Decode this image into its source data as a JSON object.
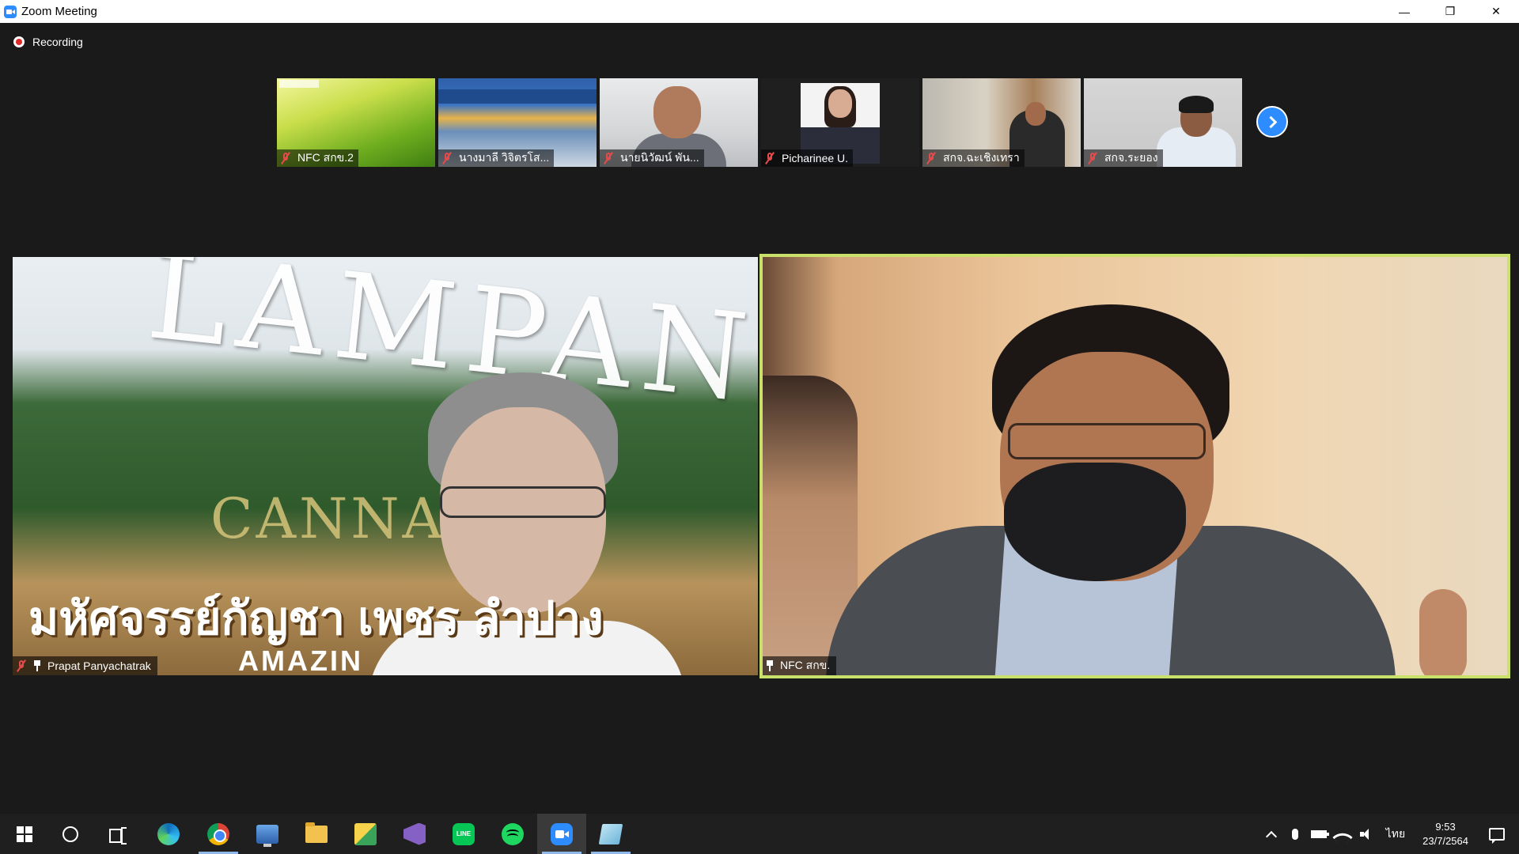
{
  "window": {
    "title": "Zoom Meeting",
    "controls": {
      "minimize": "—",
      "restore": "❐",
      "close": "✕"
    }
  },
  "recording": {
    "label": "Recording"
  },
  "thumbnails": [
    {
      "name": "NFC สกข.2",
      "muted": true
    },
    {
      "name": "นางมาลี วิจิตรโส...",
      "muted": true
    },
    {
      "name": "นายนิวัฒน์ พัน...",
      "muted": true
    },
    {
      "name": "Picharinee U.",
      "muted": true
    },
    {
      "name": "สกจ.ฉะเชิงเทรา",
      "muted": true
    },
    {
      "name": "สกจ.ระยอง",
      "muted": true
    }
  ],
  "thumbnail_banner_text": "LAMPANG",
  "main_videos": [
    {
      "name": "Prapat Panyachatrak",
      "muted": true,
      "pinned": true,
      "background_text": {
        "title": "LAMPANG",
        "subtitle": "CANNABI",
        "thai": "มหัศจรรย์กัญชา เพชร   ลำปาง",
        "english": "AMAZIN"
      }
    },
    {
      "name": "NFC สกข.",
      "muted": false,
      "pinned": true,
      "active_speaker": true
    }
  ],
  "taskbar": {
    "apps": [
      "start",
      "cortana",
      "task-view",
      "edge",
      "chrome",
      "remote-desktop",
      "file-explorer",
      "tool",
      "visual-studio",
      "line",
      "spotify",
      "zoom",
      "notepad"
    ],
    "line_label": "LINE",
    "language": "ไทย",
    "time": "9:53",
    "date": "23/7/2564"
  },
  "colors": {
    "active_speaker_border": "#c9e06a",
    "accent_blue": "#2d8cff",
    "mute_red": "#e54b4b"
  }
}
